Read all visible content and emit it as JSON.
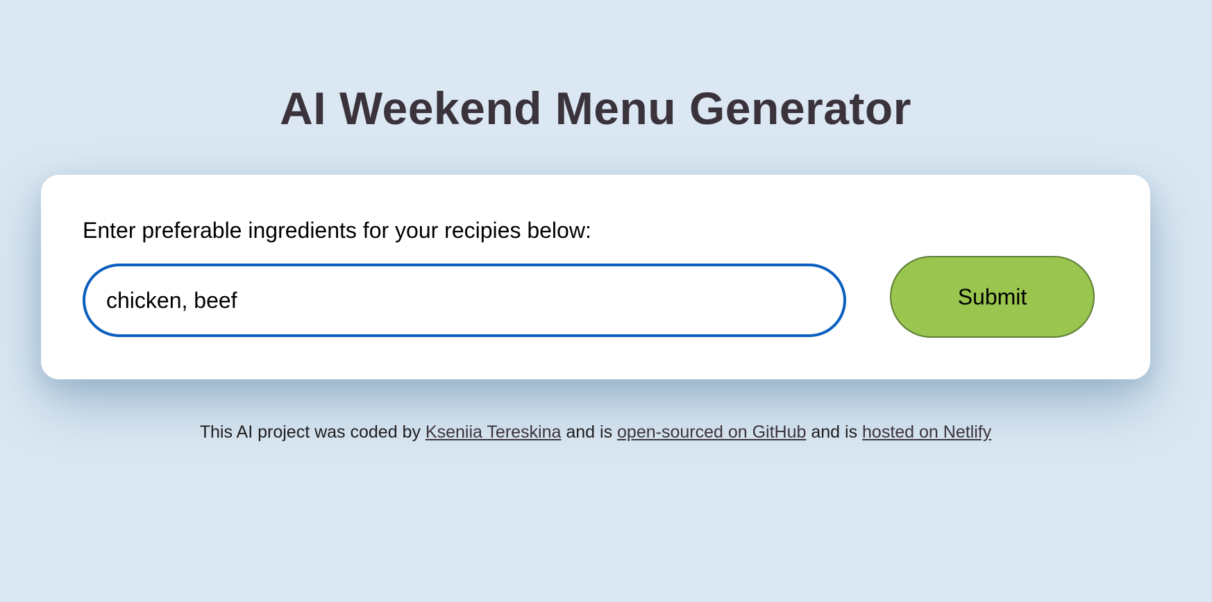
{
  "header": {
    "title": "AI Weekend Menu Generator"
  },
  "form": {
    "label": "Enter preferable ingredients for your recipies below:",
    "input_value": "chicken, beef",
    "submit_label": "Submit"
  },
  "footer": {
    "text_1": "This AI project was coded by ",
    "author_link": "Kseniia Tereskina",
    "text_2": " and is ",
    "github_link": "open-sourced on GitHub",
    "text_3": " and is ",
    "netlify_link": "hosted on Netlify"
  },
  "colors": {
    "background": "#dbe8f3",
    "title": "#3b333c",
    "input_border": "#0a5fbf",
    "submit_fill": "#9ac54e",
    "submit_border": "#5d7d36"
  }
}
